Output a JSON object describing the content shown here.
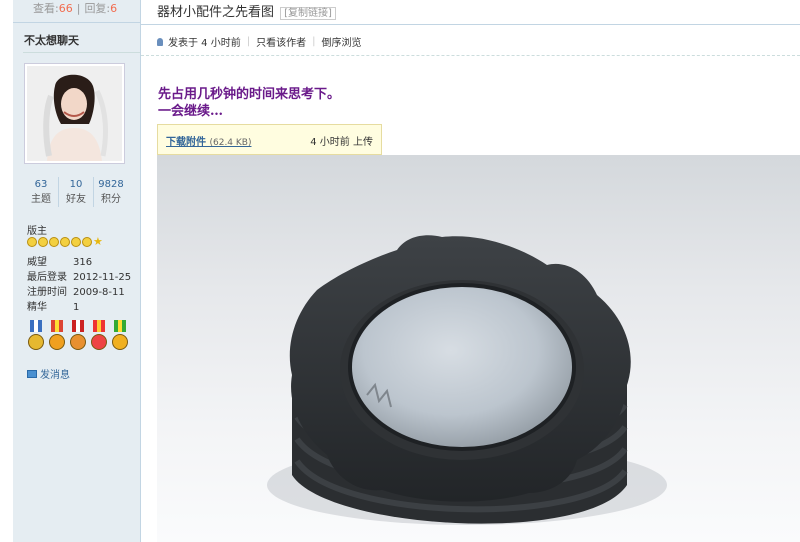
{
  "stats_bar": {
    "views_label": "查看:",
    "views": "66",
    "replies_label": "回复:",
    "replies": "6"
  },
  "user": {
    "name": "不太想聊天",
    "stats": [
      {
        "value": "63",
        "label": "主题"
      },
      {
        "value": "10",
        "label": "好友"
      },
      {
        "value": "9828",
        "label": "积分"
      }
    ],
    "role": "版主",
    "info": [
      {
        "key": "威望",
        "value": "316"
      },
      {
        "key": "最后登录",
        "value": "2012-11-25"
      },
      {
        "key": "注册时间",
        "value": "2009-8-11"
      },
      {
        "key": "精华",
        "value": "1"
      }
    ],
    "message_label": "发消息"
  },
  "post": {
    "title": "器材小配件之先看图",
    "copy_link": "[复制链接]",
    "posted": "发表于 4 小时前",
    "only_author": "只看该作者",
    "reverse": "倒序浏览",
    "body_line1": "先占用几秒钟的时间来思考下。",
    "body_line2": "一会继续…",
    "attachment": {
      "download": "下载附件",
      "size": "(62.4 KB)",
      "uploaded": "4 小时前  上传"
    }
  },
  "colors": {
    "accent": "#369",
    "highlight": "#f26c4f",
    "body_text": "#6a1a8a",
    "sidebar_bg": "#e5edf2"
  }
}
